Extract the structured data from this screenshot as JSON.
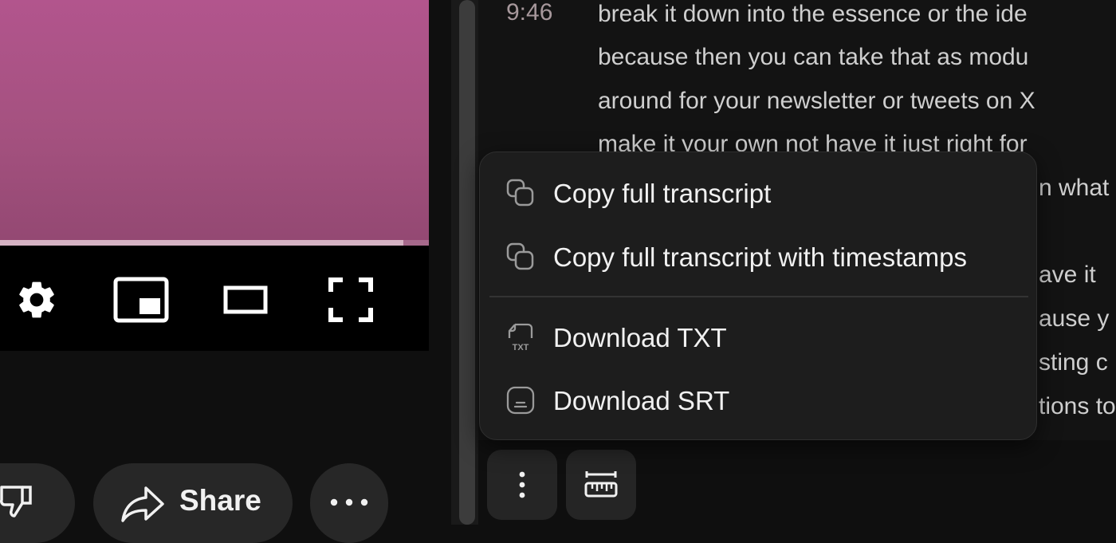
{
  "player": {
    "progress_fraction": 0.94,
    "controls": [
      "gear-icon",
      "miniplayer-icon",
      "theater-mode-icon",
      "fullscreen-icon"
    ]
  },
  "actions": {
    "share_label": "Share",
    "dislike_icon": "thumbs-down-icon",
    "more_icon": "more-horizontal-icon"
  },
  "transcript": {
    "timestamp": "9:46",
    "lines": [
      "break it down into the essence or the ide",
      "because then you can take that as modu",
      "around for your newsletter or tweets on X",
      "make it your own not have it just right for"
    ],
    "partial_lines_right": [
      "n what",
      "ave it",
      "ause y",
      "sting c",
      "tions to"
    ]
  },
  "menu": {
    "items": [
      {
        "label": "Copy full transcript",
        "icon": "copy-icon"
      },
      {
        "label": "Copy full transcript with timestamps",
        "icon": "copy-icon"
      },
      {
        "label": "Download TXT",
        "icon": "txt-file-icon",
        "icon_text": "TXT"
      },
      {
        "label": "Download SRT",
        "icon": "subtitles-file-icon"
      }
    ]
  },
  "toolbar": {
    "buttons": [
      "more-vertical-icon",
      "ruler-icon"
    ]
  },
  "colors": {
    "video_top": "#b2558d",
    "video_bottom": "#934872",
    "panel_bg": "#131313",
    "menu_bg": "#1d1d1d",
    "timestamp": "#a7989c"
  }
}
